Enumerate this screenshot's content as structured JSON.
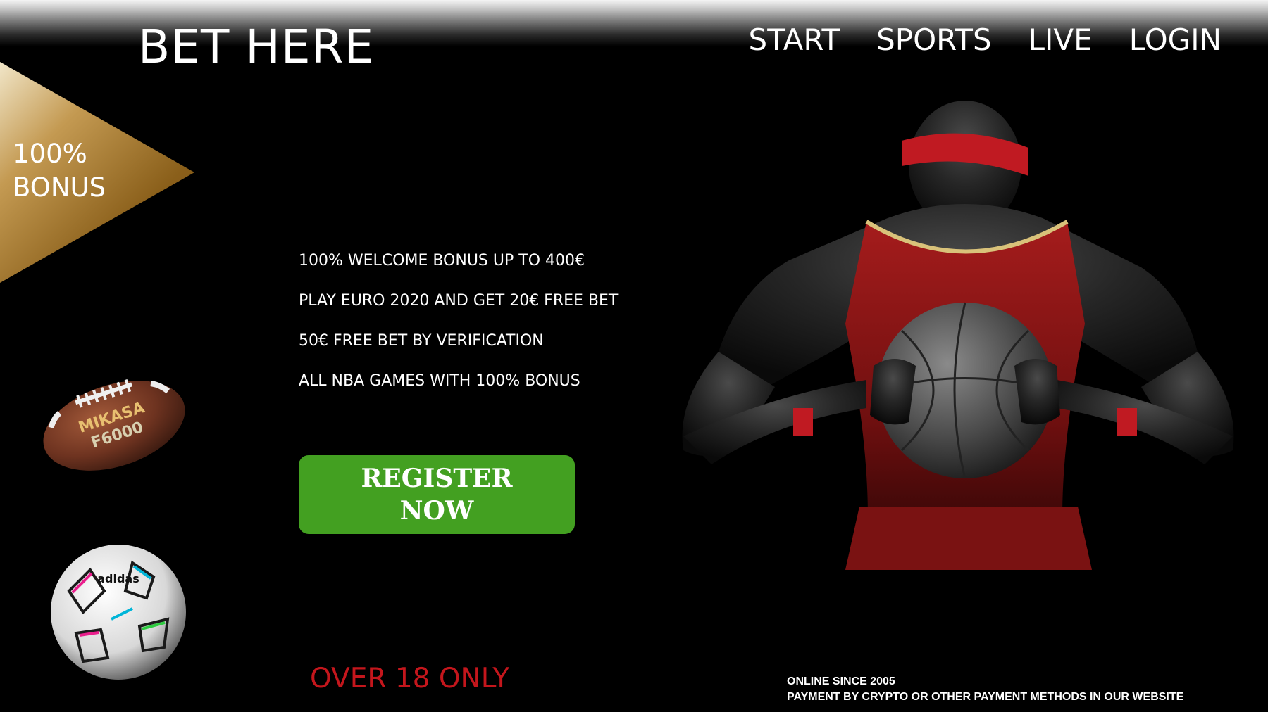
{
  "header": {
    "brand": "BET HERE",
    "nav": [
      "START",
      "SPORTS",
      "LIVE",
      "LOGIN"
    ]
  },
  "bonus_badge": {
    "line1": "100%",
    "line2": "BONUS"
  },
  "promotions": [
    "100% WELCOME BONUS UP TO 400€",
    "PLAY EURO 2020 AND GET 20€ FREE BET",
    "50€ FREE BET BY VERIFICATION",
    "ALL NBA GAMES WITH 100% BONUS"
  ],
  "cta": {
    "label": "REGISTER NOW"
  },
  "age_notice": "OVER 18 ONLY",
  "footer": {
    "line1": "ONLINE SINCE 2005",
    "line2": "PAYMENT BY CRYPTO OR OTHER PAYMENT METHODS IN OUR WEBSITE"
  },
  "images": {
    "football_label": "MIKASA F6000",
    "soccer_ball_brand": "adidas"
  },
  "colors": {
    "background": "#000000",
    "cta_green": "#43a021",
    "age_red": "#c4161c",
    "badge_gold": "#9a6a22"
  }
}
